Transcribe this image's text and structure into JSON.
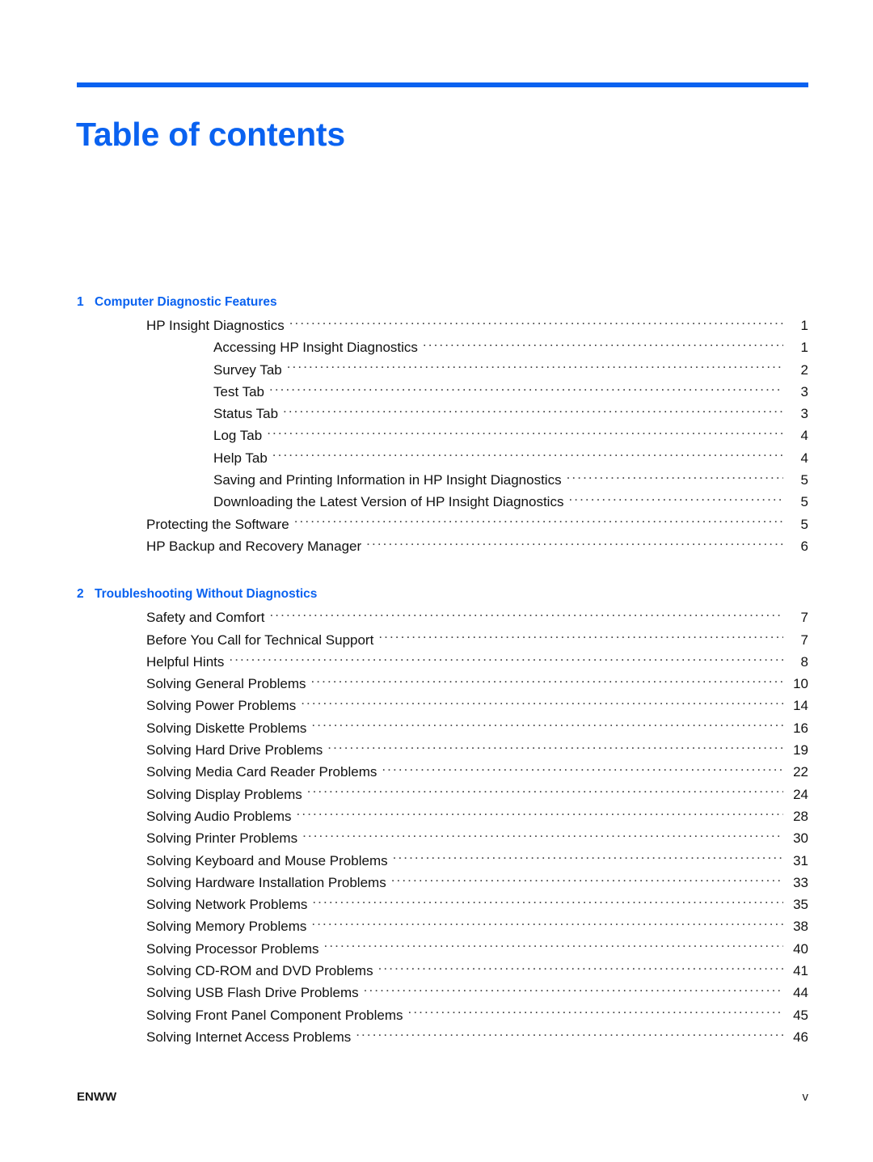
{
  "document": {
    "title": "Table of contents",
    "accent_color": "#0a62f0"
  },
  "footer": {
    "left": "ENWW",
    "right": "v"
  },
  "toc": {
    "chapters": [
      {
        "number": "1",
        "title": "Computer Diagnostic Features",
        "entries": [
          {
            "label": "HP Insight Diagnostics",
            "page": "1",
            "level": 1
          },
          {
            "label": "Accessing HP Insight Diagnostics",
            "page": "1",
            "level": 2
          },
          {
            "label": "Survey Tab",
            "page": "2",
            "level": 2
          },
          {
            "label": "Test Tab",
            "page": "3",
            "level": 2
          },
          {
            "label": "Status Tab",
            "page": "3",
            "level": 2
          },
          {
            "label": "Log Tab",
            "page": "4",
            "level": 2
          },
          {
            "label": "Help Tab",
            "page": "4",
            "level": 2
          },
          {
            "label": "Saving and Printing Information in HP Insight Diagnostics",
            "page": "5",
            "level": 2
          },
          {
            "label": "Downloading the Latest Version of HP Insight Diagnostics",
            "page": "5",
            "level": 2
          },
          {
            "label": "Protecting the Software",
            "page": "5",
            "level": 1
          },
          {
            "label": "HP Backup and Recovery Manager",
            "page": "6",
            "level": 1
          }
        ]
      },
      {
        "number": "2",
        "title": "Troubleshooting Without Diagnostics",
        "entries": [
          {
            "label": "Safety and Comfort",
            "page": "7",
            "level": 1
          },
          {
            "label": "Before You Call for Technical Support",
            "page": "7",
            "level": 1
          },
          {
            "label": "Helpful Hints",
            "page": "8",
            "level": 1
          },
          {
            "label": "Solving General Problems",
            "page": "10",
            "level": 1
          },
          {
            "label": "Solving Power Problems",
            "page": "14",
            "level": 1
          },
          {
            "label": "Solving Diskette Problems",
            "page": "16",
            "level": 1
          },
          {
            "label": "Solving Hard Drive Problems",
            "page": "19",
            "level": 1
          },
          {
            "label": "Solving Media Card Reader Problems",
            "page": "22",
            "level": 1
          },
          {
            "label": "Solving Display Problems",
            "page": "24",
            "level": 1
          },
          {
            "label": "Solving Audio Problems",
            "page": "28",
            "level": 1
          },
          {
            "label": "Solving Printer Problems",
            "page": "30",
            "level": 1
          },
          {
            "label": "Solving Keyboard and Mouse Problems",
            "page": "31",
            "level": 1
          },
          {
            "label": "Solving Hardware Installation Problems",
            "page": "33",
            "level": 1
          },
          {
            "label": "Solving Network Problems",
            "page": "35",
            "level": 1
          },
          {
            "label": "Solving Memory Problems",
            "page": "38",
            "level": 1
          },
          {
            "label": "Solving Processor Problems",
            "page": "40",
            "level": 1
          },
          {
            "label": "Solving CD-ROM and DVD Problems",
            "page": "41",
            "level": 1
          },
          {
            "label": "Solving USB Flash Drive Problems",
            "page": "44",
            "level": 1
          },
          {
            "label": "Solving Front Panel Component Problems",
            "page": "45",
            "level": 1
          },
          {
            "label": "Solving Internet Access Problems",
            "page": "46",
            "level": 1
          }
        ]
      }
    ]
  }
}
